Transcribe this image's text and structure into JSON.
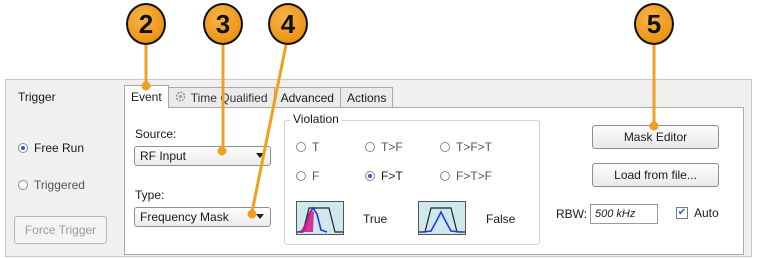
{
  "callouts": [
    "2",
    "3",
    "4",
    "5"
  ],
  "trigger": {
    "title": "Trigger",
    "free_run_label": "Free Run",
    "triggered_label": "Triggered",
    "force_trigger_label": "Force Trigger",
    "mode_selected": "Free Run"
  },
  "tabs": [
    {
      "label": "Event",
      "active": true
    },
    {
      "label": "Time Qualified",
      "active": false,
      "icon": "gear-icon"
    },
    {
      "label": "Advanced",
      "active": false
    },
    {
      "label": "Actions",
      "active": false
    }
  ],
  "event": {
    "source_label": "Source:",
    "source_value": "RF Input",
    "type_label": "Type:",
    "type_value": "Frequency Mask",
    "violation": {
      "title": "Violation",
      "options": [
        "T",
        "T>F",
        "T>F>T",
        "F",
        "F>T",
        "F>T>F"
      ],
      "selected": "F>T",
      "true_label": "True",
      "false_label": "False"
    },
    "mask_editor_label": "Mask Editor",
    "load_from_file_label": "Load from file...",
    "rbw_label": "RBW:",
    "rbw_value": "500 kHz",
    "auto_label": "Auto",
    "auto_checked": true
  },
  "colors": {
    "callout_fill": "#ef9a1c",
    "radio_selected": "#2a5fc9",
    "mask_fill": "#cfe8ee",
    "trace_magenta": "#d6178a"
  }
}
